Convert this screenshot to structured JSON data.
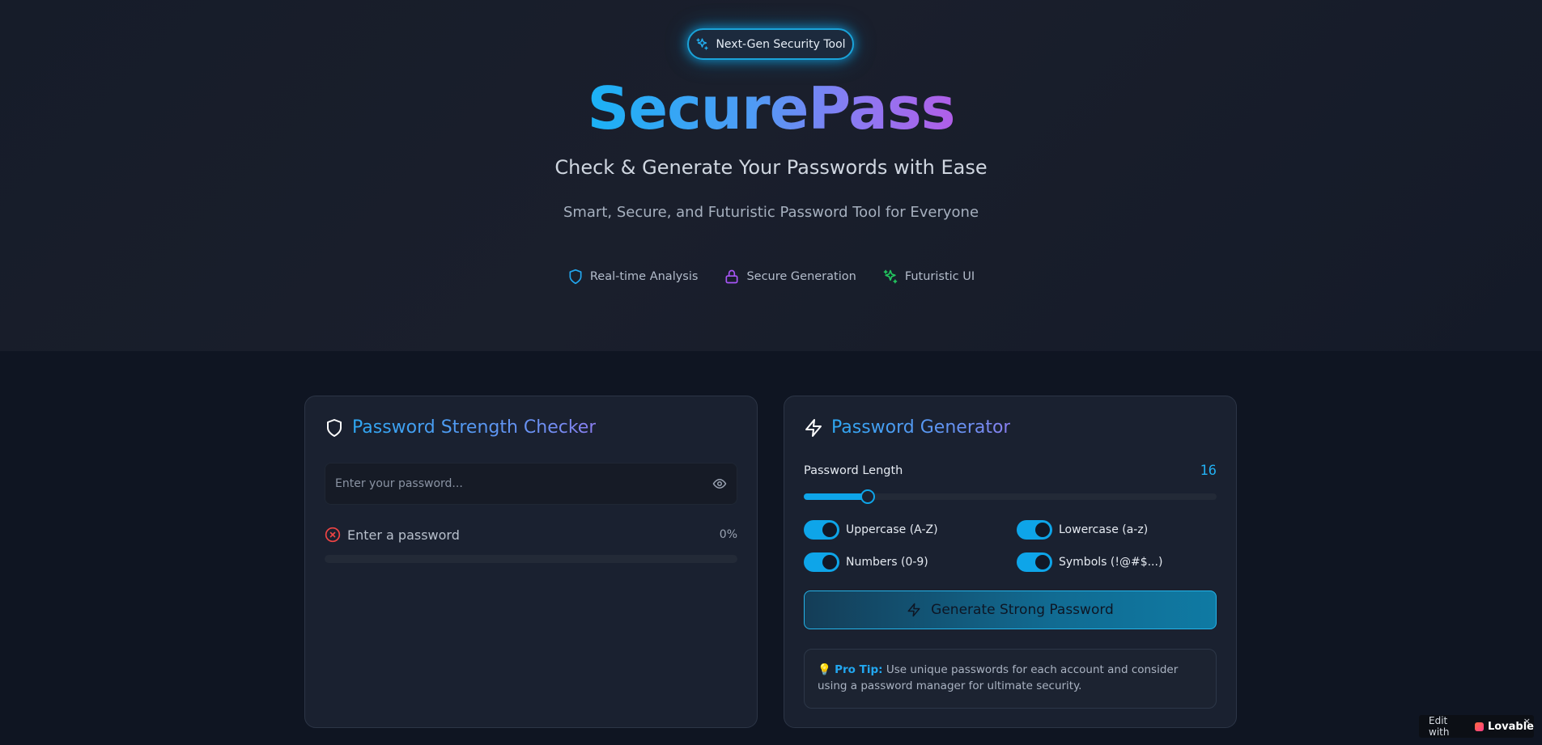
{
  "hero": {
    "badge": "Next-Gen Security Tool",
    "brand": "SecurePass",
    "subtitle": "Check & Generate Your Passwords with Ease",
    "tagline": "Smart, Secure, and Futuristic Password Tool for Everyone",
    "features": [
      {
        "label": "Real-time Analysis",
        "icon": "shield-icon",
        "color": "#22a7f0"
      },
      {
        "label": "Secure Generation",
        "icon": "lock-icon",
        "color": "#a855f7"
      },
      {
        "label": "Futuristic UI",
        "icon": "sparkles-icon",
        "color": "#22c55e"
      }
    ]
  },
  "checker": {
    "title": "Password Strength Checker",
    "input_placeholder": "Enter your password...",
    "status": "Enter a password",
    "percent": "0%",
    "strength_fraction": 0
  },
  "generator": {
    "title": "Password Generator",
    "length_label": "Password Length",
    "length_value": "16",
    "length_slider_fraction": 0.155,
    "options": {
      "uppercase": {
        "label": "Uppercase (A-Z)",
        "checked": true
      },
      "lowercase": {
        "label": "Lowercase (a-z)",
        "checked": true
      },
      "numbers": {
        "label": "Numbers (0-9)",
        "checked": true
      },
      "symbols": {
        "label": "Symbols (!@#$...)",
        "checked": true
      }
    },
    "generate_button": "Generate Strong Password",
    "tip_emoji": "💡",
    "tip_title": "Pro Tip:",
    "tip_text": "Use unique passwords for each account and consider using a password manager for ultimate security."
  },
  "lovable": {
    "prefix": "Edit with",
    "name": "Lovable",
    "close": "×"
  },
  "colors": {
    "accent": "#0ea5e9",
    "brand_gradient_start": "#1ab2f5",
    "brand_gradient_end": "#b15ee8",
    "error": "#ef4444"
  }
}
